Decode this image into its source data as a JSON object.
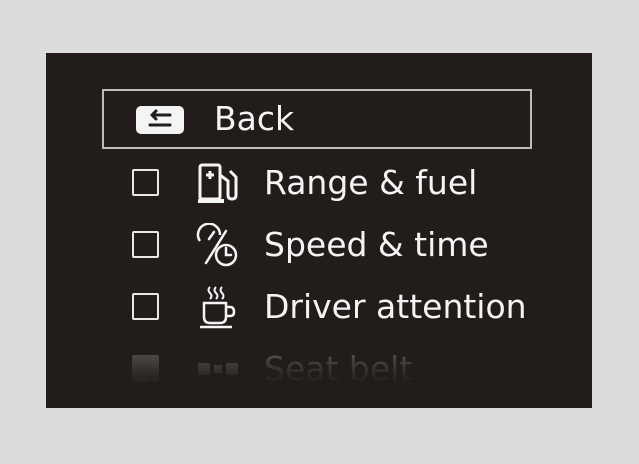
{
  "menu": {
    "back_label": "Back",
    "items": [
      {
        "label": "Range & fuel",
        "checked": false,
        "icon": "fuel-pump-icon"
      },
      {
        "label": "Speed & time",
        "checked": false,
        "icon": "speed-time-icon"
      },
      {
        "label": "Driver attention",
        "checked": false,
        "icon": "coffee-cup-icon"
      },
      {
        "label": "Seat belt",
        "checked": true,
        "icon": "seat-belt-icon"
      }
    ]
  },
  "colors": {
    "background": "#221c1b",
    "text": "#f4f4f4",
    "selection_border": "#bdbdbd",
    "page": "#dcdcdc"
  }
}
